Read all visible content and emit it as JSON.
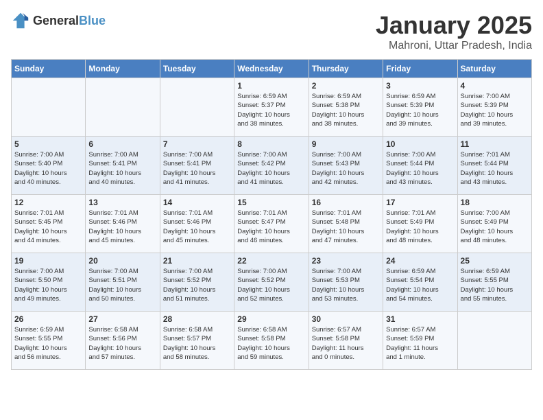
{
  "logo": {
    "general": "General",
    "blue": "Blue"
  },
  "header": {
    "month": "January 2025",
    "location": "Mahroni, Uttar Pradesh, India"
  },
  "weekdays": [
    "Sunday",
    "Monday",
    "Tuesday",
    "Wednesday",
    "Thursday",
    "Friday",
    "Saturday"
  ],
  "weeks": [
    [
      {
        "day": "",
        "info": ""
      },
      {
        "day": "",
        "info": ""
      },
      {
        "day": "",
        "info": ""
      },
      {
        "day": "1",
        "info": "Sunrise: 6:59 AM\nSunset: 5:37 PM\nDaylight: 10 hours\nand 38 minutes."
      },
      {
        "day": "2",
        "info": "Sunrise: 6:59 AM\nSunset: 5:38 PM\nDaylight: 10 hours\nand 38 minutes."
      },
      {
        "day": "3",
        "info": "Sunrise: 6:59 AM\nSunset: 5:39 PM\nDaylight: 10 hours\nand 39 minutes."
      },
      {
        "day": "4",
        "info": "Sunrise: 7:00 AM\nSunset: 5:39 PM\nDaylight: 10 hours\nand 39 minutes."
      }
    ],
    [
      {
        "day": "5",
        "info": "Sunrise: 7:00 AM\nSunset: 5:40 PM\nDaylight: 10 hours\nand 40 minutes."
      },
      {
        "day": "6",
        "info": "Sunrise: 7:00 AM\nSunset: 5:41 PM\nDaylight: 10 hours\nand 40 minutes."
      },
      {
        "day": "7",
        "info": "Sunrise: 7:00 AM\nSunset: 5:41 PM\nDaylight: 10 hours\nand 41 minutes."
      },
      {
        "day": "8",
        "info": "Sunrise: 7:00 AM\nSunset: 5:42 PM\nDaylight: 10 hours\nand 41 minutes."
      },
      {
        "day": "9",
        "info": "Sunrise: 7:00 AM\nSunset: 5:43 PM\nDaylight: 10 hours\nand 42 minutes."
      },
      {
        "day": "10",
        "info": "Sunrise: 7:00 AM\nSunset: 5:44 PM\nDaylight: 10 hours\nand 43 minutes."
      },
      {
        "day": "11",
        "info": "Sunrise: 7:01 AM\nSunset: 5:44 PM\nDaylight: 10 hours\nand 43 minutes."
      }
    ],
    [
      {
        "day": "12",
        "info": "Sunrise: 7:01 AM\nSunset: 5:45 PM\nDaylight: 10 hours\nand 44 minutes."
      },
      {
        "day": "13",
        "info": "Sunrise: 7:01 AM\nSunset: 5:46 PM\nDaylight: 10 hours\nand 45 minutes."
      },
      {
        "day": "14",
        "info": "Sunrise: 7:01 AM\nSunset: 5:46 PM\nDaylight: 10 hours\nand 45 minutes."
      },
      {
        "day": "15",
        "info": "Sunrise: 7:01 AM\nSunset: 5:47 PM\nDaylight: 10 hours\nand 46 minutes."
      },
      {
        "day": "16",
        "info": "Sunrise: 7:01 AM\nSunset: 5:48 PM\nDaylight: 10 hours\nand 47 minutes."
      },
      {
        "day": "17",
        "info": "Sunrise: 7:01 AM\nSunset: 5:49 PM\nDaylight: 10 hours\nand 48 minutes."
      },
      {
        "day": "18",
        "info": "Sunrise: 7:00 AM\nSunset: 5:49 PM\nDaylight: 10 hours\nand 48 minutes."
      }
    ],
    [
      {
        "day": "19",
        "info": "Sunrise: 7:00 AM\nSunset: 5:50 PM\nDaylight: 10 hours\nand 49 minutes."
      },
      {
        "day": "20",
        "info": "Sunrise: 7:00 AM\nSunset: 5:51 PM\nDaylight: 10 hours\nand 50 minutes."
      },
      {
        "day": "21",
        "info": "Sunrise: 7:00 AM\nSunset: 5:52 PM\nDaylight: 10 hours\nand 51 minutes."
      },
      {
        "day": "22",
        "info": "Sunrise: 7:00 AM\nSunset: 5:52 PM\nDaylight: 10 hours\nand 52 minutes."
      },
      {
        "day": "23",
        "info": "Sunrise: 7:00 AM\nSunset: 5:53 PM\nDaylight: 10 hours\nand 53 minutes."
      },
      {
        "day": "24",
        "info": "Sunrise: 6:59 AM\nSunset: 5:54 PM\nDaylight: 10 hours\nand 54 minutes."
      },
      {
        "day": "25",
        "info": "Sunrise: 6:59 AM\nSunset: 5:55 PM\nDaylight: 10 hours\nand 55 minutes."
      }
    ],
    [
      {
        "day": "26",
        "info": "Sunrise: 6:59 AM\nSunset: 5:55 PM\nDaylight: 10 hours\nand 56 minutes."
      },
      {
        "day": "27",
        "info": "Sunrise: 6:58 AM\nSunset: 5:56 PM\nDaylight: 10 hours\nand 57 minutes."
      },
      {
        "day": "28",
        "info": "Sunrise: 6:58 AM\nSunset: 5:57 PM\nDaylight: 10 hours\nand 58 minutes."
      },
      {
        "day": "29",
        "info": "Sunrise: 6:58 AM\nSunset: 5:58 PM\nDaylight: 10 hours\nand 59 minutes."
      },
      {
        "day": "30",
        "info": "Sunrise: 6:57 AM\nSunset: 5:58 PM\nDaylight: 11 hours\nand 0 minutes."
      },
      {
        "day": "31",
        "info": "Sunrise: 6:57 AM\nSunset: 5:59 PM\nDaylight: 11 hours\nand 1 minute."
      },
      {
        "day": "",
        "info": ""
      }
    ]
  ]
}
